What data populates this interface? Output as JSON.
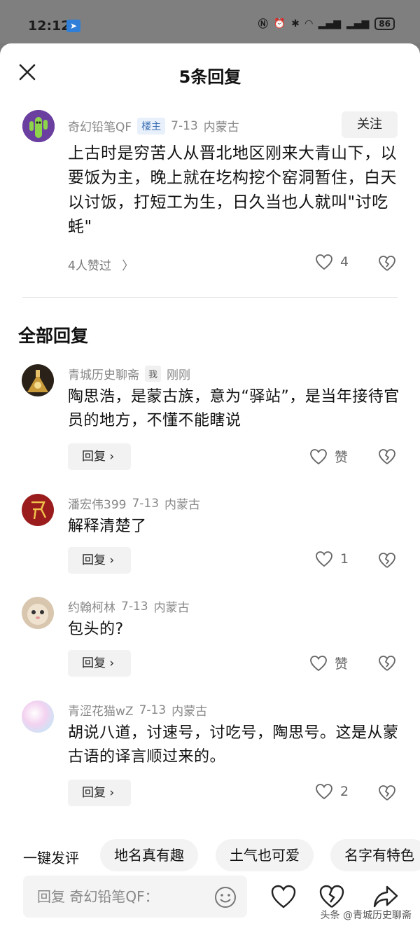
{
  "status_bar": {
    "time": "12:12",
    "battery": "86"
  },
  "header": {
    "title": "5条回复"
  },
  "root_comment": {
    "username": "奇幻铅笔QF",
    "owner_tag": "楼主",
    "date": "7-13",
    "location": "内蒙古",
    "follow_label": "关注",
    "text": "上古时是穷苦人从晋北地区刚来大青山下，以要饭为主，晚上就在圪构挖个窑洞暂住，白天以讨饭，打短工为生，日久当也人就叫\"讨吃蚝\"",
    "liked_by": "4人赞过",
    "like_count": "4"
  },
  "section_title": "全部回复",
  "replies": [
    {
      "username": "青城历史聊斋",
      "tag": "我",
      "date": "刚刚",
      "location": "",
      "text": "陶思浩，是蒙古族，意为“驿站”，是当年接待官员的地方，不懂不能瞎说",
      "reply_label": "回复",
      "like": "赞"
    },
    {
      "username": "潘宏伟399",
      "tag": "",
      "date": "7-13",
      "location": "内蒙古",
      "text": "解释清楚了",
      "reply_label": "回复",
      "like": "1"
    },
    {
      "username": "约翰柯林",
      "tag": "",
      "date": "7-13",
      "location": "内蒙古",
      "text": "包头的?",
      "reply_label": "回复",
      "like": "赞"
    },
    {
      "username": "青涩花猫wZ",
      "tag": "",
      "date": "7-13",
      "location": "内蒙古",
      "text": "胡说八道，讨速号，讨吃号，陶思号。这是从蒙古语的译言顺过来的。",
      "reply_label": "回复",
      "like": "2"
    }
  ],
  "quick_comment": {
    "label": "一键发评",
    "chips": [
      "地名真有趣",
      "土气也可爱",
      "名字有特色"
    ]
  },
  "bottom_bar": {
    "placeholder": "回复 奇幻铅笔QF："
  },
  "watermark": "头条 @青城历史聊斋",
  "colors": {
    "tag_blue": "#3b6fb6",
    "text_gray": "#888888"
  }
}
